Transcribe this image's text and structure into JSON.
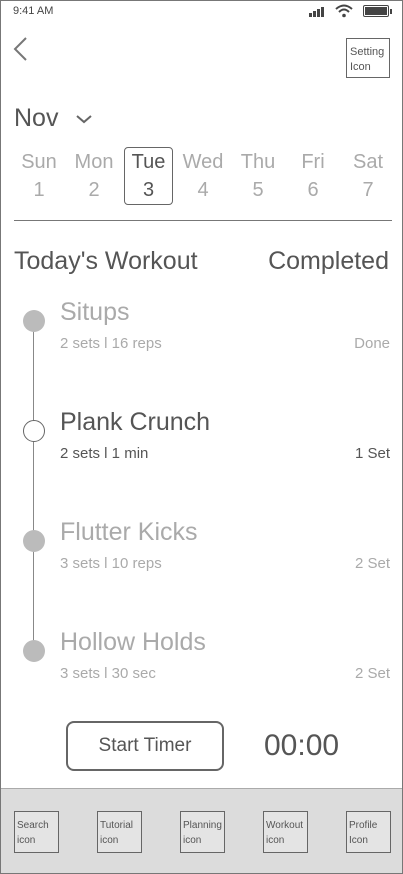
{
  "status_bar": {
    "time": "9:41 AM"
  },
  "header": {
    "setting_icon_label_1": "Setting",
    "setting_icon_label_2": "Icon"
  },
  "calendar": {
    "month": "Nov",
    "days": [
      {
        "name": "Sun",
        "date": "1"
      },
      {
        "name": "Mon",
        "date": "2"
      },
      {
        "name": "Tue",
        "date": "3",
        "selected": true
      },
      {
        "name": "Wed",
        "date": "4"
      },
      {
        "name": "Thu",
        "date": "5"
      },
      {
        "name": "Fri",
        "date": "6"
      },
      {
        "name": "Sat",
        "date": "7"
      }
    ]
  },
  "workout": {
    "title": "Today's Workout",
    "completed_label": "Completed",
    "items": [
      {
        "name": "Situps",
        "detail": "2 sets l 16 reps",
        "status": "Done",
        "state": "done"
      },
      {
        "name": "Plank Crunch",
        "detail": "2 sets l 1 min",
        "status": "1 Set",
        "state": "active"
      },
      {
        "name": "Flutter Kicks",
        "detail": "3 sets l 10 reps",
        "status": "2 Set",
        "state": "upcoming"
      },
      {
        "name": "Hollow Holds",
        "detail": "3 sets l 30 sec",
        "status": "2 Set",
        "state": "upcoming"
      }
    ]
  },
  "timer": {
    "button_label": "Start Timer",
    "value": "00:00"
  },
  "tabbar": {
    "tabs": [
      {
        "line1": "Search",
        "line2": "icon"
      },
      {
        "line1": "Tutorial",
        "line2": "icon"
      },
      {
        "line1": "Planning",
        "line2": "icon"
      },
      {
        "line1": "Workout",
        "line2": "icon"
      },
      {
        "line1": "Profile",
        "line2": "Icon"
      }
    ]
  }
}
